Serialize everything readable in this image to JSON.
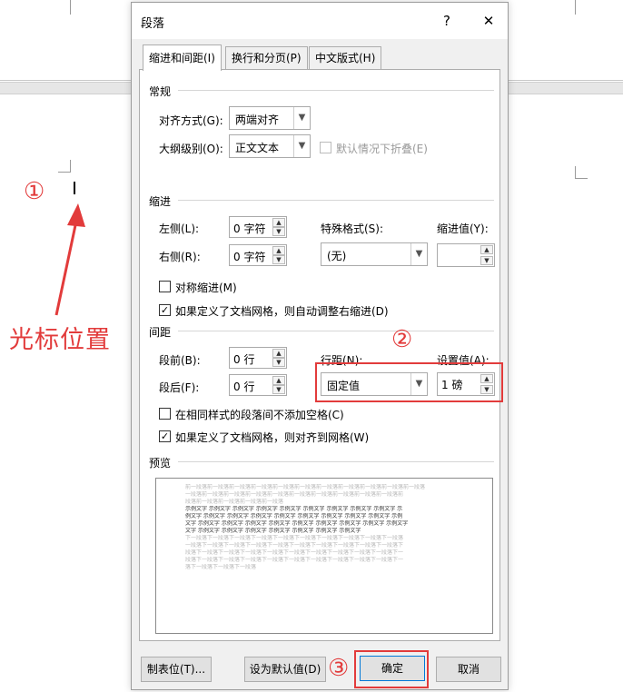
{
  "annotations": {
    "marker1": "①",
    "marker2": "②",
    "marker3": "③",
    "cursor_caption": "光标位置"
  },
  "dialog": {
    "title": "段落",
    "help": "?",
    "close": "✕",
    "tabs": [
      "缩进和间距(I)",
      "换行和分页(P)",
      "中文版式(H)"
    ],
    "general": {
      "heading": "常规",
      "alignment_label": "对齐方式(G):",
      "alignment_value": "两端对齐",
      "outline_label": "大纲级别(O):",
      "outline_value": "正文文本",
      "collapse_label": "默认情况下折叠(E)"
    },
    "indent": {
      "heading": "缩进",
      "left_label": "左侧(L):",
      "left_value": "0 字符",
      "right_label": "右侧(R):",
      "right_value": "0 字符",
      "special_label": "特殊格式(S):",
      "special_value": "(无)",
      "by_label": "缩进值(Y):",
      "by_value": "",
      "mirror_label": "对称缩进(M)",
      "auto_adjust_label": "如果定义了文档网格，则自动调整右缩进(D)"
    },
    "spacing": {
      "heading": "间距",
      "before_label": "段前(B):",
      "before_value": "0 行",
      "after_label": "段后(F):",
      "after_value": "0 行",
      "line_label": "行距(N):",
      "line_value": "固定值",
      "at_label": "设置值(A):",
      "at_value": "1 磅",
      "no_space_label": "在相同样式的段落间不添加空格(C)",
      "snap_grid_label": "如果定义了文档网格，则对齐到网格(W)"
    },
    "preview": {
      "heading": "预览",
      "prev_lines": [
        "前一段落前一段落前一段落前一段落前一段落前一段落前一段落前一段落前一段落前一段落前一段落",
        "一段落前一段落前一段落前一段落前一段落前一段落前一段落前一段落前一段落前一段落前",
        "段落前一段落前一段落前一段落前一段落"
      ],
      "sample_lines": [
        "示例文字 示例文字 示例文字 示例文字 示例文字 示例文字 示例文字 示例文字 示例文字 示",
        "例文字 示例文字 示例文字 示例文字 示例文字 示例文字 示例文字 示例文字 示例文字 示例",
        "文字 示例文字 示例文字 示例文字 示例文字 示例文字 示例文字 示例文字 示例文字 示例文字",
        "文字 示例文字 示例文字 示例文字 示例文字 示例文字 示例文字 示例文字"
      ],
      "next_lines": [
        "下一段落下一段落下一段落下一段落下一段落下一段落下一段落下一段落下一段落下一段落",
        "一段落下一段落下一段落下一段落下一段落下一段落下一段落下一段落下一段落下一段落下",
        "段落下一段落下一段落下一段落下一段落下一段落下一段落下一段落下一段落下一段落下一",
        "段落下一段落下一段落下一段落下一段落下一段落下一段落下一段落下一段落下一段落下一",
        "落下一段落下一段落下一段落"
      ]
    },
    "buttons": {
      "tabs": "制表位(T)...",
      "set_default": "设为默认值(D)",
      "ok": "确定",
      "cancel": "取消"
    }
  }
}
